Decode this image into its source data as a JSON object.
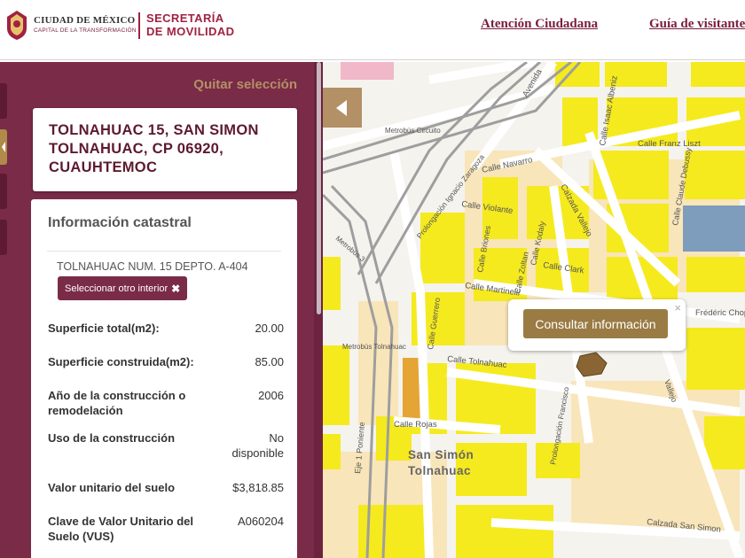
{
  "header": {
    "city_name": "CIUDAD DE MÉXICO",
    "city_tagline": "CAPITAL DE LA TRANSFORMACIÓN",
    "secretaria_line1": "SECRETARÍA",
    "secretaria_line2": "DE MOVILIDAD",
    "nav": [
      "Atención Ciudadana",
      "Guía de visitante"
    ]
  },
  "panel": {
    "clear_selection": "Quitar selección",
    "address": "TOLNAHUAC 15, SAN SIMON TOLNAHUAC, CP 06920, CUAUHTEMOC",
    "info_title": "Información catastral",
    "interior": "TOLNAHUAC NUM. 15 DEPTO. A-404",
    "select_interior_label": "Seleccionar otro interior",
    "select_interior_icon": "close-x-icon",
    "rows": [
      {
        "label": "Superficie total(m2):",
        "value": "20.00"
      },
      {
        "label": "Superficie construida(m2):",
        "value": "85.00"
      },
      {
        "label": "Año de la construcción o remodelación",
        "value": "2006"
      },
      {
        "label": "Uso de la construcción",
        "value": "No disponible"
      },
      {
        "label": "Valor unitario del suelo",
        "value": "$3,818.85"
      },
      {
        "label": "Clave de Valor Unitario del Suelo (VUS)",
        "value": "A060204"
      }
    ]
  },
  "map": {
    "labels": {
      "avenida": "Avenida",
      "calle_isaac_albeniz": "Calle Isaac Albeniz",
      "calle_franz_liszt": "Calle Franz Liszt",
      "metrobus_circuito": "Metrobús Circuito",
      "calle_navarro": "Calle Navarro",
      "prolongacion_zaragoza": "Prolongación Ignacio Zaragoza",
      "calzada_vallejo": "Calzada Vallejo",
      "calle_claude_debussy": "Calle Claude Debussy",
      "calle_violante": "Calle Violante",
      "calle_briones": "Calle Briones",
      "calle_kodaly": "Calle Kodaly",
      "calle_zoltan": "Calle Zoltan",
      "calle_clark": "Calle Clark",
      "metrobus_3": "Metrobús 3",
      "calle_martinelli": "Calle Martinelli",
      "frederic_chopin": "Frédéric Chopin",
      "calle_guerrero": "Calle Guerrero",
      "metrobus_tolnahuac": "Metrobús Tolnahuac",
      "calle_tolnahuac": "Calle Tolnahuac",
      "calle_rojas": "Calle Rojas",
      "eje_poniente": "Eje 1 Poniente",
      "prolongacion_francisco": "Prolongación Francisco",
      "colonia_san_simon": "San Simón",
      "colonia_tolnahuac": "Tolnahuac",
      "calzada_san_simon": "Calzada San Simon",
      "vallejo": "Vallejo"
    },
    "popup_action": "Consultar información",
    "popup_close": "×",
    "colors": {
      "block_yellow": "#f5ea1e",
      "block_beige": "#f8e5b9",
      "road_gray": "#9e9e9e",
      "selected_parcel": "#8a6533",
      "accent_maroon": "#7a2b48",
      "accent_gold": "#b39065"
    }
  }
}
